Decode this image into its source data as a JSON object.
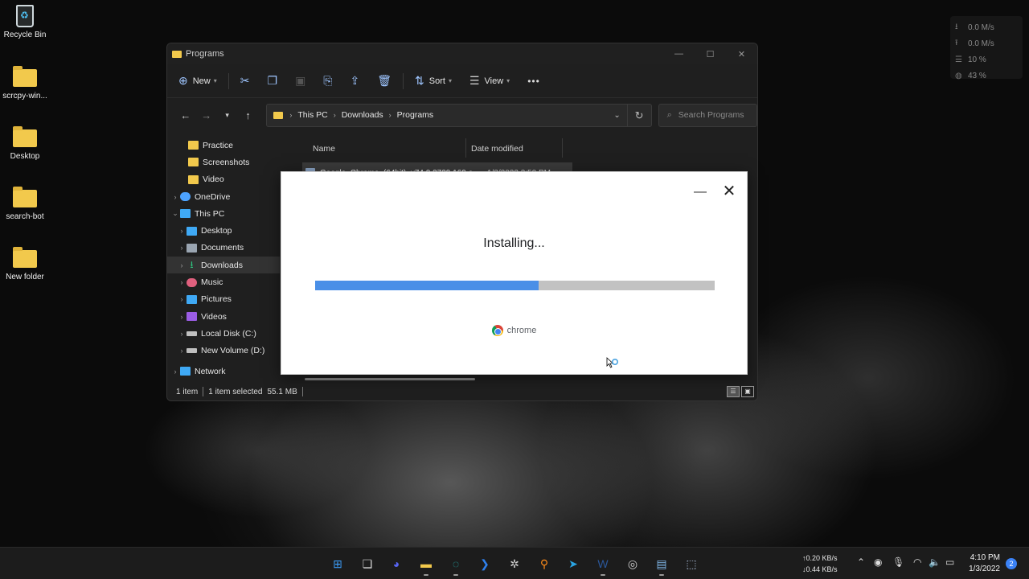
{
  "desktop": {
    "icons": [
      {
        "label": "Recycle Bin"
      },
      {
        "label": "scrcpy-win..."
      },
      {
        "label": "Desktop"
      },
      {
        "label": "search-bot"
      },
      {
        "label": "New folder"
      }
    ]
  },
  "net_widget": {
    "download": "0.0 M/s",
    "upload": "0.0 M/s",
    "cpu": "10 %",
    "memory": "43 %"
  },
  "explorer": {
    "title": "Programs",
    "toolbar": {
      "new_label": "New",
      "sort_label": "Sort",
      "view_label": "View",
      "more_label": "•••"
    },
    "breadcrumb": [
      "This PC",
      "Downloads",
      "Programs"
    ],
    "search_placeholder": "Search Programs",
    "nav_items": [
      {
        "label": "Practice",
        "level": 1,
        "icon": "folder-icon",
        "color": "#f2c94c"
      },
      {
        "label": "Screenshots",
        "level": 1,
        "icon": "folder-icon",
        "color": "#f2c94c"
      },
      {
        "label": "Video",
        "level": 1,
        "icon": "folder-icon",
        "color": "#f2c94c"
      },
      {
        "label": "OneDrive",
        "level": 0,
        "icon": "cloud-icon",
        "color": "#4da3ff"
      },
      {
        "label": "This PC",
        "level": 0,
        "icon": "computer-icon",
        "color": "#3fa9f5"
      },
      {
        "label": "Desktop",
        "level": 1,
        "icon": "desktop-icon",
        "color": "#3fa9f5"
      },
      {
        "label": "Documents",
        "level": 1,
        "icon": "document-icon",
        "color": "#9aa5b1"
      },
      {
        "label": "Downloads",
        "level": 1,
        "icon": "download-icon",
        "color": "#2ec27e"
      },
      {
        "label": "Music",
        "level": 1,
        "icon": "music-icon",
        "color": "#e0607e"
      },
      {
        "label": "Pictures",
        "level": 1,
        "icon": "pictures-icon",
        "color": "#3fa9f5"
      },
      {
        "label": "Videos",
        "level": 1,
        "icon": "videos-icon",
        "color": "#9b5de5"
      },
      {
        "label": "Local Disk (C:)",
        "level": 1,
        "icon": "drive-icon",
        "color": "#bfbfbf"
      },
      {
        "label": "New Volume (D:)",
        "level": 1,
        "icon": "drive-icon",
        "color": "#bfbfbf"
      },
      {
        "label": "Network",
        "level": 0,
        "icon": "network-icon",
        "color": "#3fa9f5"
      }
    ],
    "columns": {
      "name": "Name",
      "date": "Date modified"
    },
    "files": [
      {
        "name": "Google_Chrome_(64bit)_v74.0.3729.169.e...",
        "date": "1/3/2022 3:50 PM"
      }
    ],
    "status": {
      "count": "1 item",
      "selected": "1 item selected",
      "size": "55.1 MB"
    }
  },
  "installer": {
    "status_text": "Installing...",
    "progress_percent": 56,
    "brand": "chrome",
    "minimize": "—",
    "close": "✕"
  },
  "taskbar": {
    "apps": [
      {
        "name": "start-icon",
        "color": "#3b9bf5"
      },
      {
        "name": "task-view-icon",
        "color": "#d9d9d9"
      },
      {
        "name": "discord-icon",
        "color": "#5865f2"
      },
      {
        "name": "file-explorer-icon",
        "color": "#f2c94c"
      },
      {
        "name": "edge-icon",
        "color": "#25b3b3"
      },
      {
        "name": "vscode-icon",
        "color": "#2f80ed"
      },
      {
        "name": "app-icon",
        "color": "#cfcfcf"
      },
      {
        "name": "search-app-icon",
        "color": "#ff8c1a"
      },
      {
        "name": "telegram-icon",
        "color": "#2aa3e0"
      },
      {
        "name": "word-icon",
        "color": "#2b579a"
      },
      {
        "name": "obs-icon",
        "color": "#cfcfcf"
      },
      {
        "name": "remote-desktop-icon",
        "color": "#7fb7e8"
      },
      {
        "name": "installer-icon",
        "color": "#a8bad4"
      }
    ],
    "net_up": "0.20 KB/s",
    "net_down": "0.44 KB/s",
    "time": "4:10 PM",
    "date": "1/3/2022",
    "notifications": "2"
  }
}
